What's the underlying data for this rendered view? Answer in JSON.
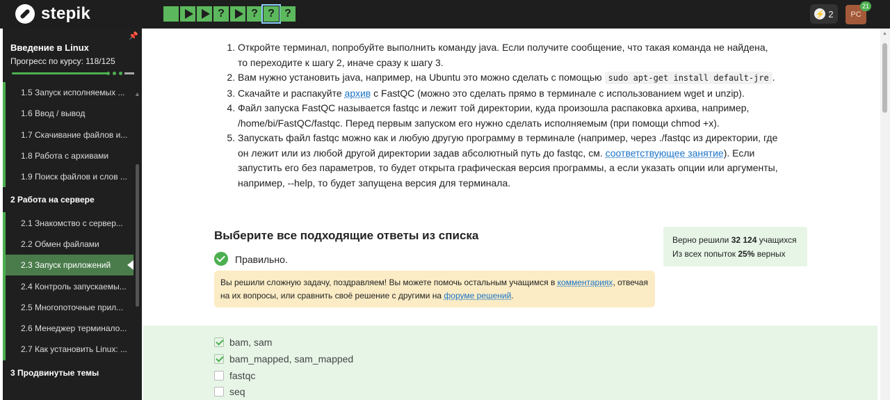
{
  "app": {
    "logo_text": "stepik"
  },
  "topbar": {
    "steps": [
      {
        "type": "theory",
        "glyph": ""
      },
      {
        "type": "video",
        "glyph": ""
      },
      {
        "type": "video",
        "glyph": ""
      },
      {
        "type": "quiz",
        "glyph": "?"
      },
      {
        "type": "video",
        "glyph": ""
      },
      {
        "type": "quiz",
        "glyph": "?"
      },
      {
        "type": "quiz",
        "glyph": "?",
        "active": true
      },
      {
        "type": "quiz",
        "glyph": "?"
      }
    ],
    "energy_count": "2",
    "avatar_initials": "PC",
    "notifications": "21"
  },
  "sidebar": {
    "course_title": "Введение в Linux",
    "progress_label": "Прогресс по курсу:  118/125",
    "items": [
      {
        "label": "1.5  Запуск исполняемых ...",
        "section": false
      },
      {
        "label": "1.6  Ввод / вывод",
        "section": false
      },
      {
        "label": "1.7  Скачивание файлов и...",
        "section": false
      },
      {
        "label": "1.8  Работа с архивами",
        "section": false
      },
      {
        "label": "1.9  Поиск файлов и слов ...",
        "section": false
      },
      {
        "label": "2  Работа на сервере",
        "section": true
      },
      {
        "label": "2.1  Знакомство с сервер...",
        "section": false
      },
      {
        "label": "2.2  Обмен файлами",
        "section": false
      },
      {
        "label": "2.3  Запуск приложений",
        "section": false,
        "active": true
      },
      {
        "label": "2.4  Контроль запускаемы...",
        "section": false
      },
      {
        "label": "2.5  Многопоточные прил...",
        "section": false
      },
      {
        "label": "2.6  Менеджер терминало...",
        "section": false
      },
      {
        "label": "2.7  Как установить Linux: ...",
        "section": false
      },
      {
        "label": "3  Продвинутые темы",
        "section": true
      }
    ]
  },
  "content": {
    "step1": "Откройте терминал, попробуйте выполнить команду java. Если получите сообщение, что такая команда не найдена, то переходите к шагу 2, иначе сразу к шагу 3.",
    "step2_pre": "Вам нужно установить java, например, на Ubuntu это можно сделать с помощью ",
    "step2_code": "sudo apt-get install default-jre",
    "step2_post": ".",
    "step3_pre": "Скачайте и распакуйте ",
    "step3_link": "архив",
    "step3_post": " с FastQC (можно это сделать прямо в терминале с использованием wget и unzip).",
    "step4": "Файл запуска FastQC называется fastqc и лежит той директории, куда произошла распаковка архива, например, /home/bi/FastQC/fastqc. Перед первым запуском его нужно сделать исполняемым (при помощи chmod +x).",
    "step5_pre": "Запускать файл fastqc можно как и любую другую программу в терминале (например, через ./fastqc из директории, где он лежит или из любой другой директории задав абсолютный путь до fastqc, см. ",
    "step5_link": "соответствующее занятие",
    "step5_post": "). Если запустить его без параметров, то будет открыта графическая версия программы, а если указать опции или аргументы, например, --help, то будет запущена версия для терминала."
  },
  "quiz": {
    "title": "Выберите все подходящие ответы из списка",
    "stats_line1_pre": "Верно решили ",
    "stats_solved": "32 124",
    "stats_line1_post": " учащихся",
    "stats_line2_pre": "Из всех попыток ",
    "stats_percent": "25%",
    "stats_line2_post": " верных",
    "result": "Правильно.",
    "congrats_pre": "Вы решили сложную задачу, поздравляем! Вы можете помочь остальным учащимся в ",
    "congrats_link1": "комментариях",
    "congrats_mid": ", отвечая на их вопросы, или сравнить своё решение с другими на ",
    "congrats_link2": "форуме решений",
    "congrats_post": ".",
    "options": [
      {
        "label": "bam, sam",
        "checked": true
      },
      {
        "label": "bam_mapped, sam_mapped",
        "checked": true
      },
      {
        "label": "fastqc",
        "checked": false
      },
      {
        "label": "seq",
        "checked": false
      }
    ]
  },
  "colors": {
    "accent": "#4caf50",
    "topbar": "#1e1e1e",
    "link": "#1a73c8",
    "success_bg": "#e7f5e7",
    "notice_bg": "#fbecc5"
  }
}
